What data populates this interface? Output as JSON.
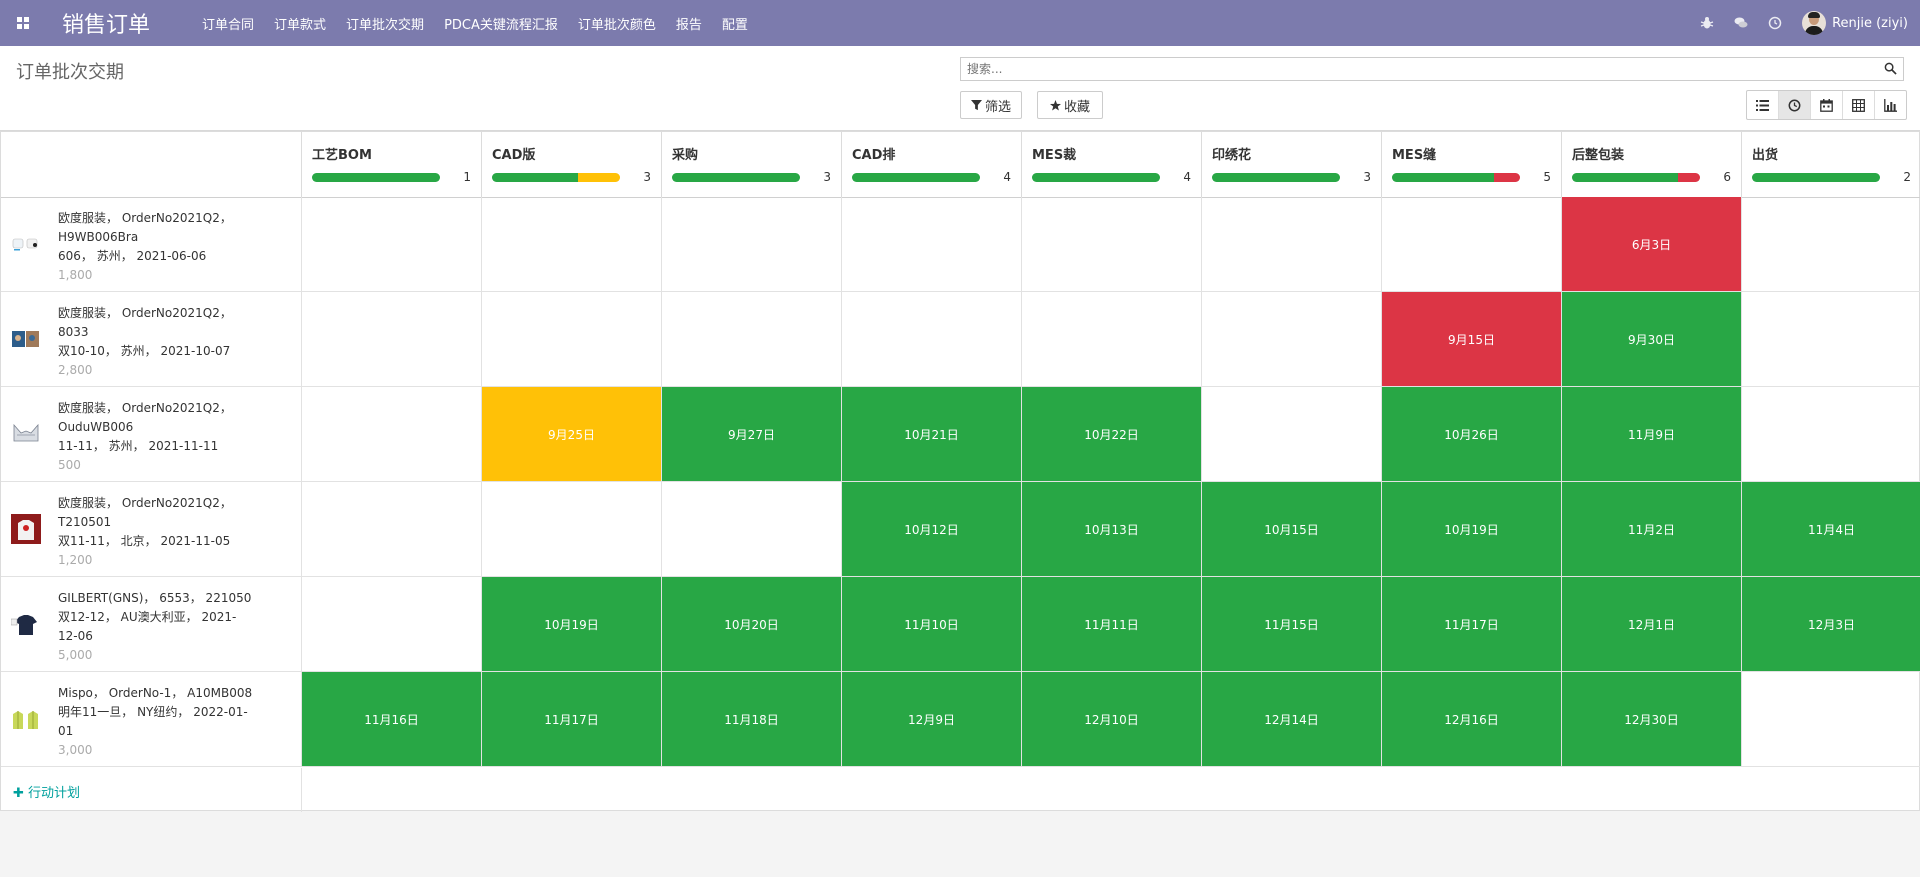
{
  "navbar": {
    "brand": "销售订单",
    "menu": [
      "订单合同",
      "订单款式",
      "订单批次交期",
      "PDCA关键流程汇报",
      "订单批次颜色",
      "报告",
      "配置"
    ],
    "user": "Renjie (ziyi)",
    "icons": [
      "apps-icon",
      "bug-icon",
      "chat-icon",
      "clock-icon"
    ]
  },
  "control": {
    "title": "订单批次交期",
    "search_placeholder": "搜索...",
    "filter_label": "筛选",
    "favorites_label": "收藏",
    "views": [
      "list-view",
      "activity-view",
      "calendar-view",
      "pivot-view",
      "graph-view"
    ],
    "active_view": "activity-view"
  },
  "colors": {
    "green": "#28a745",
    "yellow": "#ffc107",
    "red": "#dc3545",
    "navbar": "#7c7bad",
    "link": "#00a09d"
  },
  "columns": [
    {
      "title": "工艺BOM",
      "count": "1",
      "progress": {
        "green": 1.0,
        "yellow": 0,
        "red": 0
      }
    },
    {
      "title": "CAD版",
      "count": "3",
      "progress": {
        "green": 0.67,
        "yellow": 0.33,
        "red": 0
      }
    },
    {
      "title": "采购",
      "count": "3",
      "progress": {
        "green": 1.0,
        "yellow": 0,
        "red": 0
      }
    },
    {
      "title": "CAD排",
      "count": "4",
      "progress": {
        "green": 1.0,
        "yellow": 0,
        "red": 0
      }
    },
    {
      "title": "MES裁",
      "count": "4",
      "progress": {
        "green": 1.0,
        "yellow": 0,
        "red": 0
      }
    },
    {
      "title": "印绣花",
      "count": "3",
      "progress": {
        "green": 1.0,
        "yellow": 0,
        "red": 0
      }
    },
    {
      "title": "MES缝",
      "count": "5",
      "progress": {
        "green": 0.8,
        "yellow": 0,
        "red": 0.2
      }
    },
    {
      "title": "后整包装",
      "count": "6",
      "progress": {
        "green": 0.83,
        "yellow": 0,
        "red": 0.17
      }
    },
    {
      "title": "出货",
      "count": "2",
      "progress": {
        "green": 1.0,
        "yellow": 0,
        "red": 0
      }
    }
  ],
  "rows": [
    {
      "lines": [
        "欧度服装， OrderNo2021Q2，",
        "H9WB006Bra",
        "606， 苏州， 2021-06-06"
      ],
      "qty": "1,800",
      "thumb": "white-set",
      "cells": [
        null,
        null,
        null,
        null,
        null,
        null,
        null,
        {
          "text": "6月3日",
          "status": "red"
        },
        null
      ]
    },
    {
      "lines": [
        "欧度服装， OrderNo2021Q2，",
        "8033",
        "双10-10， 苏州， 2021-10-07"
      ],
      "qty": "2,800",
      "thumb": "print-set",
      "cells": [
        null,
        null,
        null,
        null,
        null,
        null,
        {
          "text": "9月15日",
          "status": "red"
        },
        {
          "text": "9月30日",
          "status": "green"
        },
        null
      ]
    },
    {
      "lines": [
        "欧度服装， OrderNo2021Q2，",
        "OuduWB006",
        "11-11， 苏州， 2021-11-11"
      ],
      "qty": "500",
      "thumb": "grey-bra",
      "cells": [
        null,
        {
          "text": "9月25日",
          "status": "yellow"
        },
        {
          "text": "9月27日",
          "status": "green"
        },
        {
          "text": "10月21日",
          "status": "green"
        },
        {
          "text": "10月22日",
          "status": "green"
        },
        null,
        {
          "text": "10月26日",
          "status": "green"
        },
        {
          "text": "11月9日",
          "status": "green"
        },
        null
      ]
    },
    {
      "lines": [
        "欧度服装， OrderNo2021Q2，",
        "T210501",
        "双11-11， 北京， 2021-11-05"
      ],
      "qty": "1,200",
      "thumb": "red-shirt",
      "cells": [
        null,
        null,
        null,
        {
          "text": "10月12日",
          "status": "green"
        },
        {
          "text": "10月13日",
          "status": "green"
        },
        {
          "text": "10月15日",
          "status": "green"
        },
        {
          "text": "10月19日",
          "status": "green"
        },
        {
          "text": "11月2日",
          "status": "green"
        },
        {
          "text": "11月4日",
          "status": "green"
        }
      ]
    },
    {
      "lines": [
        "GILBERT(GNS)， 6553， 221050",
        "双12-12， AU澳大利亚， 2021-",
        "12-06"
      ],
      "qty": "5,000",
      "thumb": "navy-tee",
      "cells": [
        null,
        {
          "text": "10月19日",
          "status": "green"
        },
        {
          "text": "10月20日",
          "status": "green"
        },
        {
          "text": "11月10日",
          "status": "green"
        },
        {
          "text": "11月11日",
          "status": "green"
        },
        {
          "text": "11月15日",
          "status": "green"
        },
        {
          "text": "11月17日",
          "status": "green"
        },
        {
          "text": "12月1日",
          "status": "green"
        },
        {
          "text": "12月3日",
          "status": "green"
        }
      ]
    },
    {
      "lines": [
        "Mispo， OrderNo-1， A10MB008",
        "明年11一旦， NY纽约， 2022-01-",
        "01"
      ],
      "qty": "3,000",
      "thumb": "yellow-jacket",
      "cells": [
        {
          "text": "11月16日",
          "status": "green"
        },
        {
          "text": "11月17日",
          "status": "green"
        },
        {
          "text": "11月18日",
          "status": "green"
        },
        {
          "text": "12月9日",
          "status": "green"
        },
        {
          "text": "12月10日",
          "status": "green"
        },
        {
          "text": "12月14日",
          "status": "green"
        },
        {
          "text": "12月16日",
          "status": "green"
        },
        {
          "text": "12月30日",
          "status": "green"
        },
        null
      ]
    }
  ],
  "add_label": "行动计划"
}
